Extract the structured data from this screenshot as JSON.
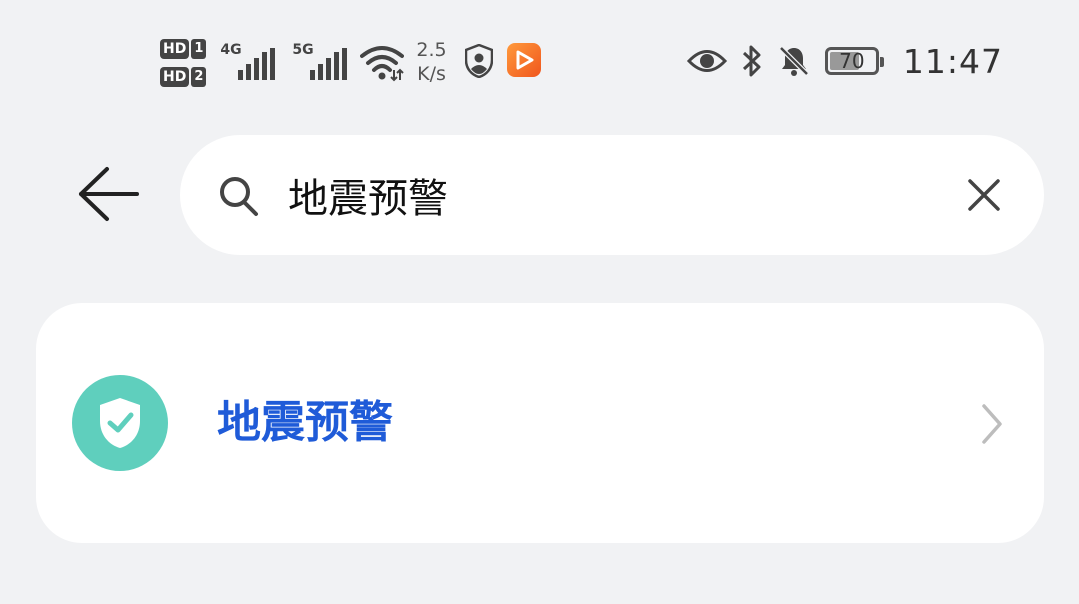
{
  "status_bar": {
    "sim1_label": "HD",
    "sim1_num": "1",
    "sim2_label": "HD",
    "sim2_num": "2",
    "network1": "4G",
    "network2": "5G",
    "speed_value": "2.5",
    "speed_unit": "K/s",
    "battery": "70",
    "battery_level_percent": 70,
    "time": "11:47"
  },
  "search": {
    "query": "地震预警"
  },
  "results": [
    {
      "label": "地震预警",
      "icon": "shield-check-icon",
      "icon_color": "#5fcfbd",
      "label_color": "#1f5bd8"
    }
  ],
  "colors": {
    "background": "#f1f2f4",
    "card": "#ffffff",
    "accent": "#1f5bd8"
  }
}
